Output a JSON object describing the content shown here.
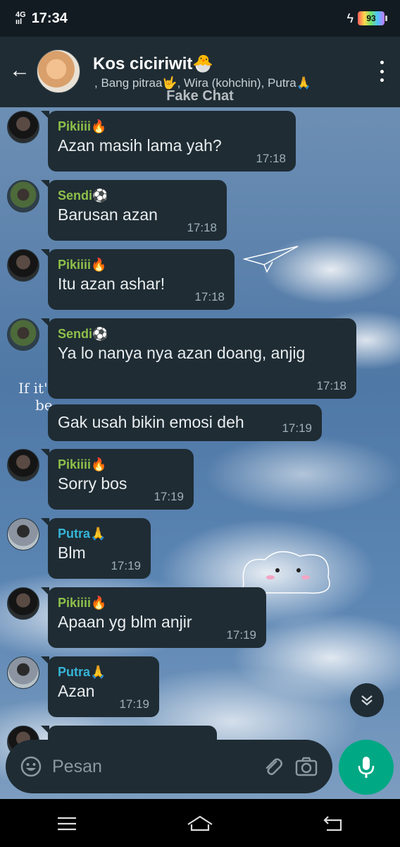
{
  "status_bar": {
    "network": "4G",
    "signal": "ııl",
    "time": "17:34",
    "battery": "93"
  },
  "header": {
    "back_icon": "arrow-left-icon",
    "title": "Kos ciciriwit🐣",
    "subtitle": ", Bang pitraa🤟, Wira (kohchin), Putra🙏",
    "menu_icon": "more-vert-icon"
  },
  "overlay_label": "Fake Chat",
  "wallpaper": {
    "text_line1": "If it'",
    "text_line2": "be"
  },
  "colors": {
    "header_bg": "#1f2c34",
    "bubble_bg": "#1f2c34",
    "accent": "#00a884",
    "sender_green": "#8ec04a",
    "sender_blue": "#35b5d8"
  },
  "messages": [
    {
      "sender": "Pikiiii🔥",
      "text": "Azan masih lama yah?",
      "time": "17:18"
    },
    {
      "sender": "Sendi⚽",
      "text": "Barusan azan",
      "time": "17:18"
    },
    {
      "sender": "Pikiiii🔥",
      "text": "Itu azan ashar!",
      "time": "17:18"
    },
    {
      "sender": "Sendi⚽",
      "text": "Ya lo nanya nya azan doang, anjig",
      "time": "17:18"
    },
    {
      "sender": "",
      "text": "Gak usah bikin emosi deh",
      "time": "17:19"
    },
    {
      "sender": "Pikiiii🔥",
      "text": "Sorry bos",
      "time": "17:19"
    },
    {
      "sender": "Putra🙏",
      "text": "Blm",
      "time": "17:19"
    },
    {
      "sender": "Pikiiii🔥",
      "text": "Apaan yg blm anjir",
      "time": "17:19"
    },
    {
      "sender": "Putra🙏",
      "text": "Azan",
      "time": "17:19"
    }
  ],
  "composer": {
    "placeholder": "Pesan",
    "emoji_icon": "emoji-icon",
    "attach_icon": "paperclip-icon",
    "camera_icon": "camera-icon",
    "mic_icon": "mic-icon"
  },
  "navbar": {
    "menu_icon": "menu-icon",
    "home_icon": "home-icon",
    "back_icon": "back-icon"
  }
}
